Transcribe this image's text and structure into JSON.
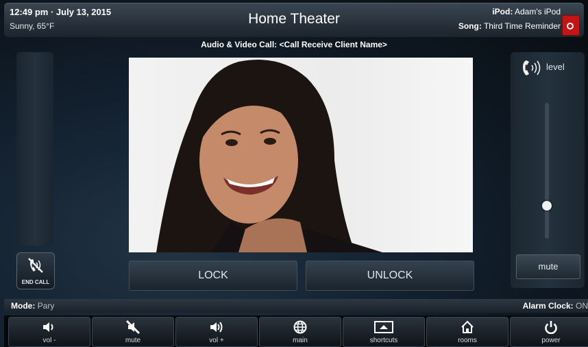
{
  "header": {
    "datetime": "12:49 pm · July 13, 2015",
    "weather": "Sunny, 65°F",
    "title": "Home Theater",
    "ipod_label": "iPod:",
    "ipod_value": "Adam's iPod",
    "song_label": "Song:",
    "song_value": "Third Time Reminder"
  },
  "call": {
    "title": "Audio & Video Call: <Call Receive Client Name>",
    "end_call_label": "END CALL",
    "lock_label": "LOCK",
    "unlock_label": "UNLOCK"
  },
  "volume": {
    "label": "level",
    "level": 0.24,
    "mute_label": "mute"
  },
  "status": {
    "mode_label": "Mode:",
    "mode_value": "Pary",
    "alarm_label": "Alarm Clock:",
    "alarm_value": "ON"
  },
  "nav": [
    {
      "label": "vol -",
      "icon": "speaker-minus-icon"
    },
    {
      "label": "mute",
      "icon": "mute-icon"
    },
    {
      "label": "vol +",
      "icon": "speaker-plus-icon"
    },
    {
      "label": "main",
      "icon": "globe-icon"
    },
    {
      "label": "shortcuts",
      "icon": "shortcuts-icon"
    },
    {
      "label": "rooms",
      "icon": "home-icon"
    },
    {
      "label": "power",
      "icon": "power-icon"
    }
  ],
  "colors": {
    "accent_red": "#c21616",
    "panel_dark": "#1b2630"
  }
}
